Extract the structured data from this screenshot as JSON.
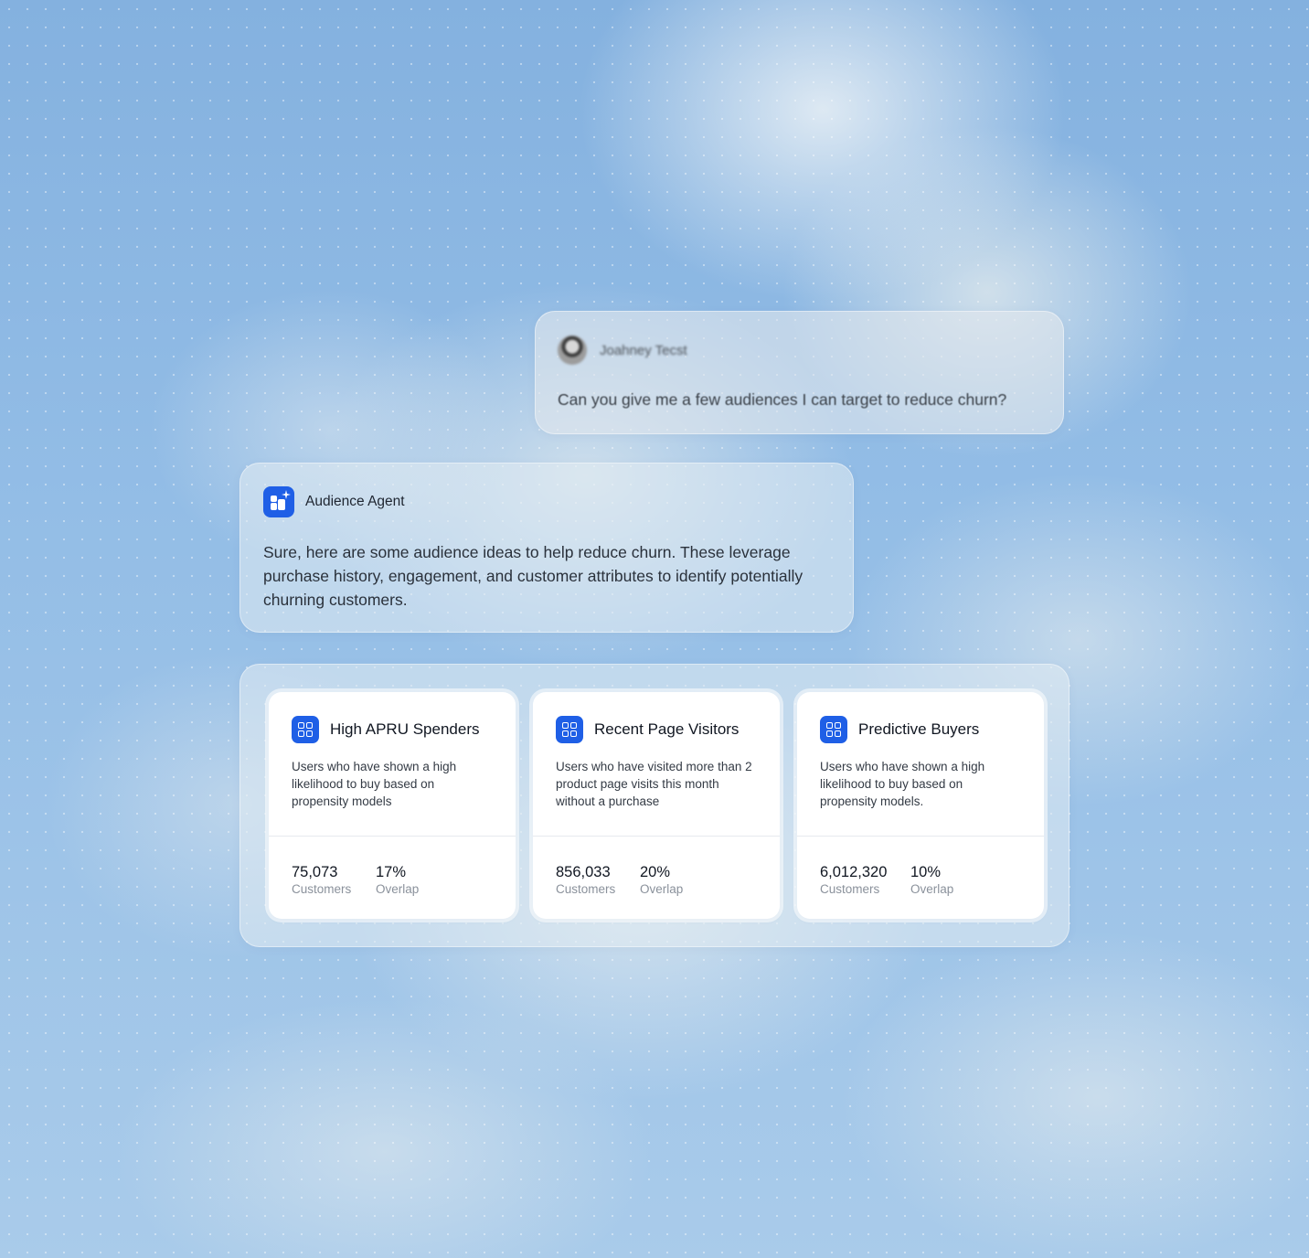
{
  "user_message": {
    "name": "Joahney Tecst",
    "text": "Can you give me a few audiences I can target to reduce churn?"
  },
  "agent_message": {
    "name": "Audience Agent",
    "text": "Sure, here are some audience ideas to help reduce churn. These leverage purchase history, engagement, and customer attributes to identify potentially churning customers."
  },
  "audiences": [
    {
      "title": "High APRU Spenders",
      "description": "Users who have shown a high likelihood to buy based on propensity models",
      "customers": "75,073",
      "customers_label": "Customers",
      "overlap": "17%",
      "overlap_label": "Overlap"
    },
    {
      "title": "Recent Page Visitors",
      "description": "Users who have visited more than 2 product page visits this month without a purchase",
      "customers": "856,033",
      "customers_label": "Customers",
      "overlap": "20%",
      "overlap_label": "Overlap"
    },
    {
      "title": "Predictive Buyers",
      "description": "Users who have shown a high likelihood to buy based on propensity models.",
      "customers": "6,012,320",
      "customers_label": "Customers",
      "overlap": "10%",
      "overlap_label": "Overlap"
    }
  ],
  "icons": {
    "avatar": "avatar",
    "agent": "audience-agent-icon",
    "audience": "audience-grid-icon"
  },
  "colors": {
    "accent": "#1f5fe6",
    "sky": "#93bde6"
  }
}
